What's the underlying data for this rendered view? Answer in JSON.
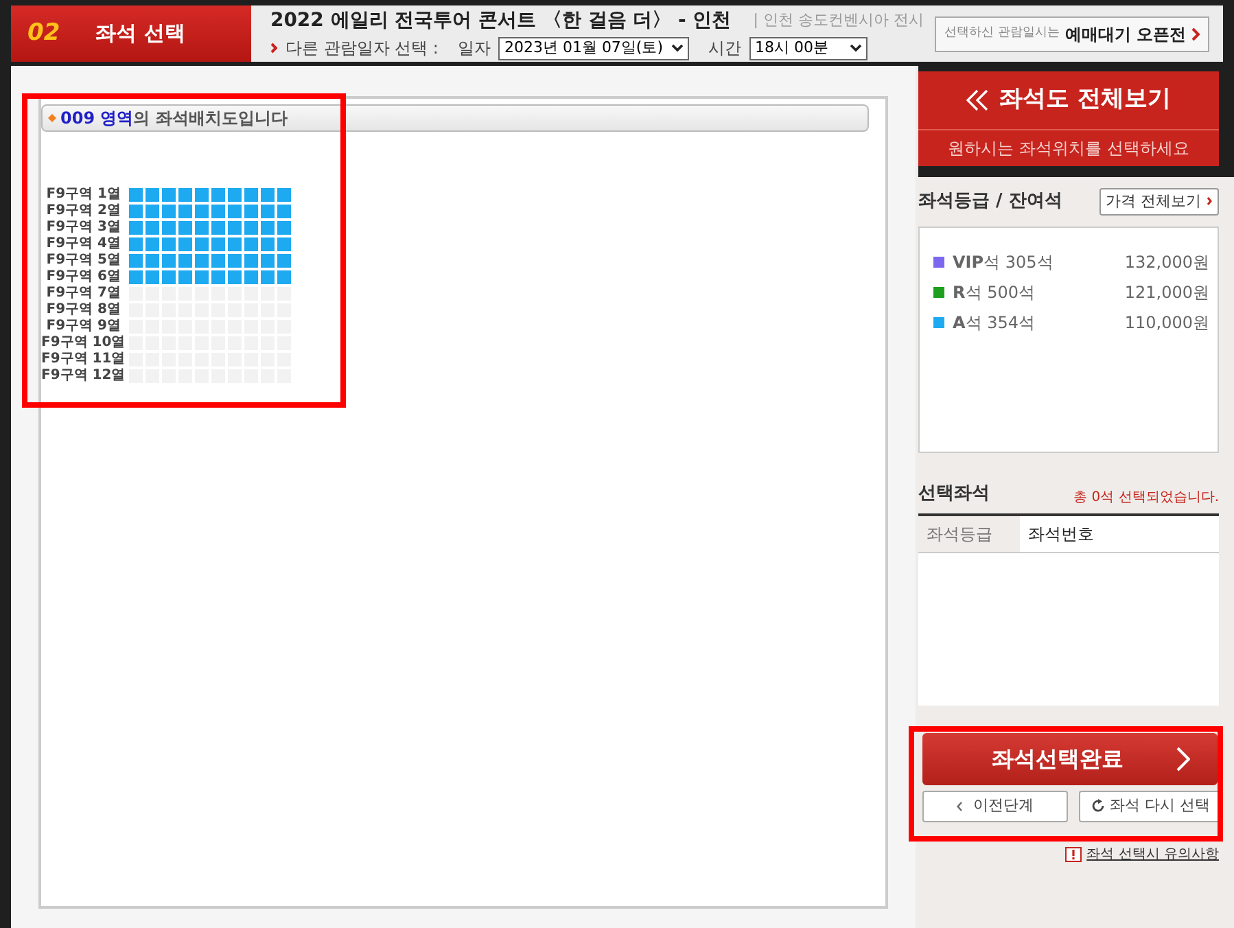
{
  "step": {
    "number": "02",
    "title": "좌석 선택"
  },
  "header": {
    "title": "2022 에일리 전국투어 콘서트 〈한 걸음 더〉 - 인천",
    "venue": "| 인천 송도컨벤시아 전시",
    "other_dates_label": "다른 관람일자 선택 :",
    "date_label": "일자",
    "date_value": "2023년 01월 07일(토)",
    "time_label": "시간",
    "time_value": "18시 00분",
    "notice_text": "선택하신 관람일시는",
    "notice_link": "예매대기 오픈전"
  },
  "seat_map": {
    "heading": "**009 영역**의 좌석배치도입니다",
    "rows": [
      {
        "label": "F9구역 1열",
        "available": true
      },
      {
        "label": "F9구역 2열",
        "available": true
      },
      {
        "label": "F9구역 3열",
        "available": true
      },
      {
        "label": "F9구역 4열",
        "available": true
      },
      {
        "label": "F9구역 5열",
        "available": true
      },
      {
        "label": "F9구역 6열",
        "available": true
      },
      {
        "label": "F9구역 7열",
        "available": false
      },
      {
        "label": "F9구역 8열",
        "available": false
      },
      {
        "label": "F9구역 9열",
        "available": false
      },
      {
        "label": "F9구역 10열",
        "available": false
      },
      {
        "label": "F9구역 11열",
        "available": false
      },
      {
        "label": "F9구역 12열",
        "available": false
      }
    ]
  },
  "sidebar": {
    "overview_button": "좌석도 전체보기",
    "overview_hint": "원하시는 좌석위치를 선택하세요",
    "grades_title": "좌석등급 / 잔여석",
    "price_button": "가격 전체보기",
    "grades": [
      {
        "name": "VIP",
        "count": "석 305석",
        "price": "132,000원",
        "color": "#7b68ee"
      },
      {
        "name": "R",
        "count": "석 500석",
        "price": "121,000원",
        "color": "#1ea01e"
      },
      {
        "name": "A",
        "count": "석 354석",
        "price": "110,000원",
        "color": "#1eaaf1"
      }
    ],
    "selected_title": "선택좌석",
    "selected_count": "총 0석 선택되었습니다.",
    "columns": [
      "좌석등급",
      "좌석번호"
    ],
    "complete_button": "좌석선택완료",
    "prev_button": "이전단계",
    "reset_button": "좌석 다시 선택",
    "notice_link": "좌석 선택시 유의사항"
  }
}
